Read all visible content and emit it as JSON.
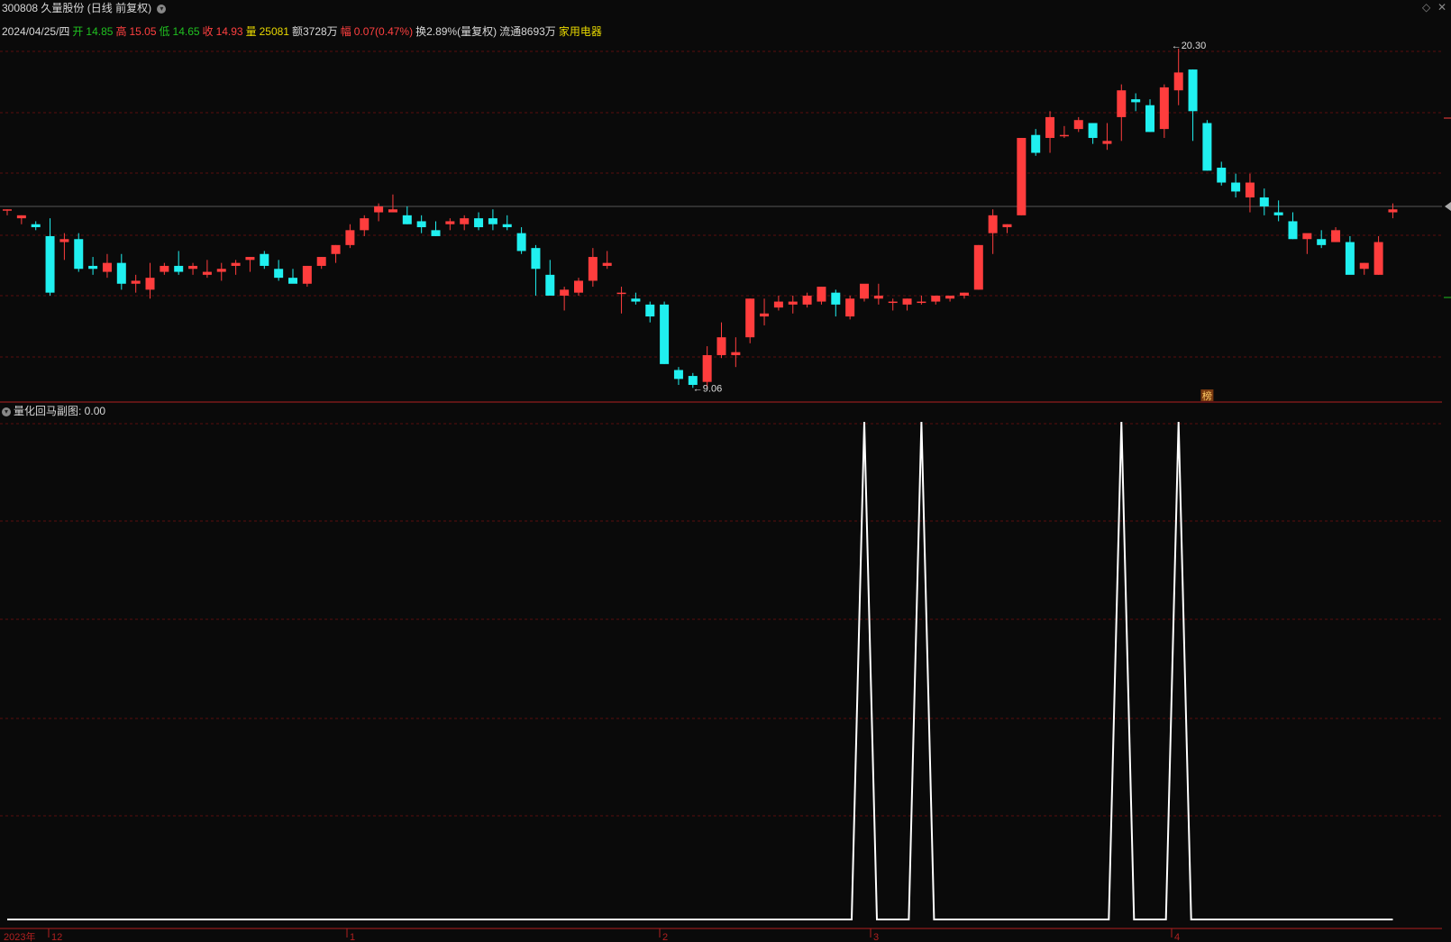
{
  "header": {
    "code": "300808",
    "name": "久量股份",
    "mode": "(日线 前复权)"
  },
  "info": {
    "date": "2024/04/25/四",
    "open_label": "开",
    "open": "14.85",
    "high_label": "高",
    "high": "15.05",
    "low_label": "低",
    "low": "14.65",
    "close_label": "收",
    "close": "14.93",
    "vol_label": "量",
    "vol": "25081",
    "amount": "额3728万",
    "change_label": "幅",
    "change": "0.07(0.47%)",
    "turnover": "换2.89%(量复权)",
    "float": "流通8693万",
    "sector": "家用电器"
  },
  "sub": {
    "label": "量化回马副图",
    "value": ": 0.00"
  },
  "colors": {
    "up": "#ff3d3d",
    "down": "#20f0f0",
    "grid": "#5a0f0f",
    "axis": "#b02020",
    "open": "#20c020",
    "vol": "#e8d800",
    "sector": "#e8d800"
  },
  "chart_data": [
    {
      "type": "candlestick",
      "ohlc": [
        [
          14.9,
          14.9,
          14.7,
          14.9
        ],
        [
          14.6,
          14.7,
          14.4,
          14.7
        ],
        [
          14.4,
          14.5,
          14.2,
          14.3
        ],
        [
          14.0,
          14.6,
          12.0,
          12.1
        ],
        [
          13.8,
          14.1,
          13.2,
          13.9
        ],
        [
          13.9,
          14.1,
          12.8,
          12.9
        ],
        [
          13.0,
          13.3,
          12.7,
          12.9
        ],
        [
          12.8,
          13.4,
          12.6,
          13.1
        ],
        [
          13.1,
          13.4,
          12.2,
          12.4
        ],
        [
          12.4,
          12.7,
          12.1,
          12.5
        ],
        [
          12.2,
          13.1,
          11.9,
          12.6
        ],
        [
          12.8,
          13.1,
          12.7,
          13.0
        ],
        [
          13.0,
          13.5,
          12.7,
          12.8
        ],
        [
          12.9,
          13.1,
          12.7,
          13.0
        ],
        [
          12.7,
          13.2,
          12.6,
          12.8
        ],
        [
          12.8,
          13.1,
          12.5,
          12.9
        ],
        [
          13.0,
          13.2,
          12.7,
          13.1
        ],
        [
          13.2,
          13.3,
          12.8,
          13.3
        ],
        [
          13.4,
          13.5,
          12.9,
          13.0
        ],
        [
          12.9,
          13.2,
          12.5,
          12.6
        ],
        [
          12.6,
          12.9,
          12.5,
          12.4
        ],
        [
          12.4,
          13.0,
          12.3,
          13.0
        ],
        [
          13.0,
          13.3,
          12.9,
          13.3
        ],
        [
          13.4,
          13.7,
          13.1,
          13.7
        ],
        [
          13.7,
          14.4,
          13.6,
          14.2
        ],
        [
          14.2,
          14.7,
          14.0,
          14.6
        ],
        [
          14.8,
          15.1,
          14.5,
          15.0
        ],
        [
          14.8,
          15.4,
          14.8,
          14.9
        ],
        [
          14.7,
          15.0,
          14.4,
          14.4
        ],
        [
          14.5,
          14.7,
          14.1,
          14.3
        ],
        [
          14.2,
          14.5,
          14.0,
          14.0
        ],
        [
          14.4,
          14.6,
          14.2,
          14.5
        ],
        [
          14.4,
          14.7,
          14.2,
          14.6
        ],
        [
          14.6,
          14.8,
          14.2,
          14.3
        ],
        [
          14.6,
          14.9,
          14.2,
          14.4
        ],
        [
          14.4,
          14.7,
          14.2,
          14.3
        ],
        [
          14.1,
          14.3,
          13.4,
          13.5
        ],
        [
          13.6,
          13.7,
          12.0,
          12.9
        ],
        [
          12.7,
          13.2,
          12.3,
          12.0
        ],
        [
          12.0,
          12.3,
          11.5,
          12.2
        ],
        [
          12.1,
          12.6,
          12.0,
          12.5
        ],
        [
          12.5,
          13.6,
          12.3,
          13.3
        ],
        [
          13.0,
          13.5,
          12.9,
          13.1
        ],
        [
          12.1,
          12.3,
          11.4,
          12.1
        ],
        [
          11.9,
          12.1,
          11.7,
          11.8
        ],
        [
          11.7,
          11.8,
          11.1,
          11.3
        ],
        [
          11.7,
          11.8,
          9.7,
          9.7
        ],
        [
          9.5,
          9.6,
          9.0,
          9.2
        ],
        [
          9.3,
          9.4,
          8.9,
          9.0
        ],
        [
          9.1,
          10.3,
          8.9,
          10.0
        ],
        [
          10.0,
          11.1,
          9.9,
          10.6
        ],
        [
          10.0,
          10.6,
          9.6,
          10.1
        ],
        [
          10.6,
          11.9,
          10.4,
          11.9
        ],
        [
          11.3,
          11.9,
          11.0,
          11.4
        ],
        [
          11.6,
          12.0,
          11.5,
          11.8
        ],
        [
          11.7,
          12.0,
          11.4,
          11.8
        ],
        [
          11.7,
          12.1,
          11.6,
          12.0
        ],
        [
          11.8,
          12.3,
          11.7,
          12.3
        ],
        [
          12.1,
          12.2,
          11.3,
          11.7
        ],
        [
          11.3,
          12.0,
          11.2,
          11.9
        ],
        [
          11.9,
          12.3,
          11.8,
          12.4
        ],
        [
          11.9,
          12.4,
          11.7,
          12.0
        ],
        [
          11.8,
          11.9,
          11.5,
          11.8
        ],
        [
          11.7,
          11.9,
          11.5,
          11.9
        ],
        [
          11.8,
          12.0,
          11.7,
          11.8
        ],
        [
          11.8,
          12.0,
          11.7,
          12.0
        ],
        [
          11.9,
          12.0,
          11.8,
          12.0
        ],
        [
          12.0,
          12.1,
          11.9,
          12.1
        ],
        [
          12.2,
          13.7,
          12.2,
          13.7
        ],
        [
          14.1,
          14.9,
          13.4,
          14.7
        ],
        [
          14.3,
          14.4,
          14.1,
          14.4
        ],
        [
          14.7,
          17.3,
          14.7,
          17.3
        ],
        [
          17.4,
          17.6,
          16.7,
          16.8
        ],
        [
          17.3,
          18.2,
          16.8,
          18.0
        ],
        [
          17.4,
          17.7,
          17.3,
          17.4
        ],
        [
          17.6,
          18.0,
          17.5,
          17.9
        ],
        [
          17.8,
          17.8,
          17.1,
          17.3
        ],
        [
          17.1,
          17.8,
          16.9,
          17.2
        ],
        [
          18.0,
          19.1,
          17.2,
          18.9
        ],
        [
          18.6,
          18.8,
          18.2,
          18.5
        ],
        [
          18.4,
          18.6,
          17.5,
          17.5
        ],
        [
          17.6,
          19.1,
          17.3,
          19.0
        ],
        [
          18.9,
          20.3,
          18.4,
          19.5
        ],
        [
          19.6,
          19.6,
          17.2,
          18.2
        ],
        [
          17.8,
          17.9,
          16.2,
          16.2
        ],
        [
          16.3,
          16.5,
          15.7,
          15.8
        ],
        [
          15.8,
          16.1,
          15.3,
          15.5
        ],
        [
          15.3,
          16.1,
          14.8,
          15.8
        ],
        [
          15.3,
          15.6,
          14.7,
          15.0
        ],
        [
          14.8,
          15.2,
          14.5,
          14.7
        ],
        [
          14.5,
          14.8,
          13.9,
          13.9
        ],
        [
          13.9,
          14.0,
          13.4,
          14.1
        ],
        [
          13.9,
          14.2,
          13.6,
          13.7
        ],
        [
          13.8,
          14.3,
          13.8,
          14.2
        ],
        [
          13.8,
          14.0,
          12.8,
          12.7
        ],
        [
          12.9,
          13.1,
          12.7,
          13.1
        ],
        [
          12.7,
          14.0,
          12.7,
          13.8
        ],
        [
          14.8,
          15.1,
          14.6,
          14.9
        ]
      ],
      "annotations": {
        "high": "20.30",
        "low": "9.06",
        "marker": "榜"
      },
      "date_axis": [
        "2023年",
        "12",
        "1",
        "2",
        "3",
        "4"
      ]
    },
    {
      "type": "line",
      "name": "量化回马副图",
      "peaks_at_bar": [
        60,
        64,
        78,
        82
      ]
    }
  ]
}
